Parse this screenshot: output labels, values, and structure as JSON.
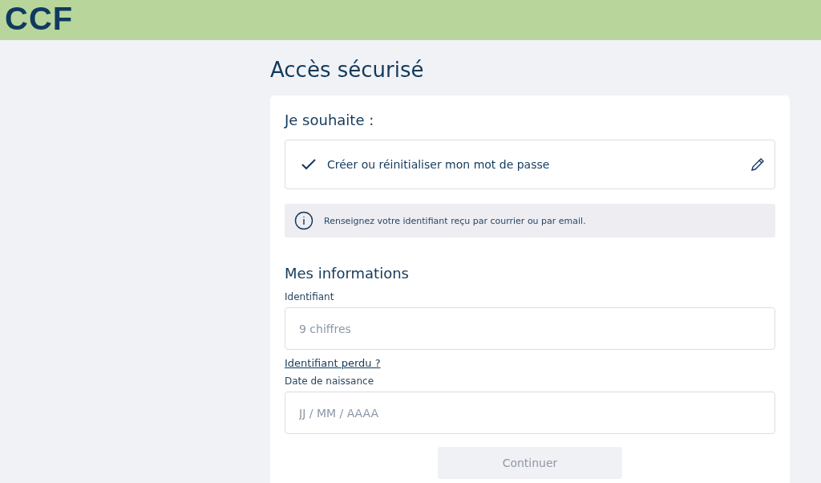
{
  "header": {
    "logo": "CCF"
  },
  "title": "Accès sécurisé",
  "choice": {
    "heading": "Je souhaite :",
    "selected_option": "Créer ou réinitialiser mon mot de passe",
    "checked": true
  },
  "info": "Renseignez votre identifiant reçu par courrier ou par email.",
  "section": {
    "heading": "Mes informations"
  },
  "fields": [
    {
      "label": "Identifiant",
      "placeholder": "9 chiffres",
      "link": "Identifiant perdu ?"
    },
    {
      "label": "Date de naissance",
      "placeholder": "JJ / MM / AAAA"
    }
  ],
  "button": {
    "label": "Continuer",
    "disabled": true
  }
}
